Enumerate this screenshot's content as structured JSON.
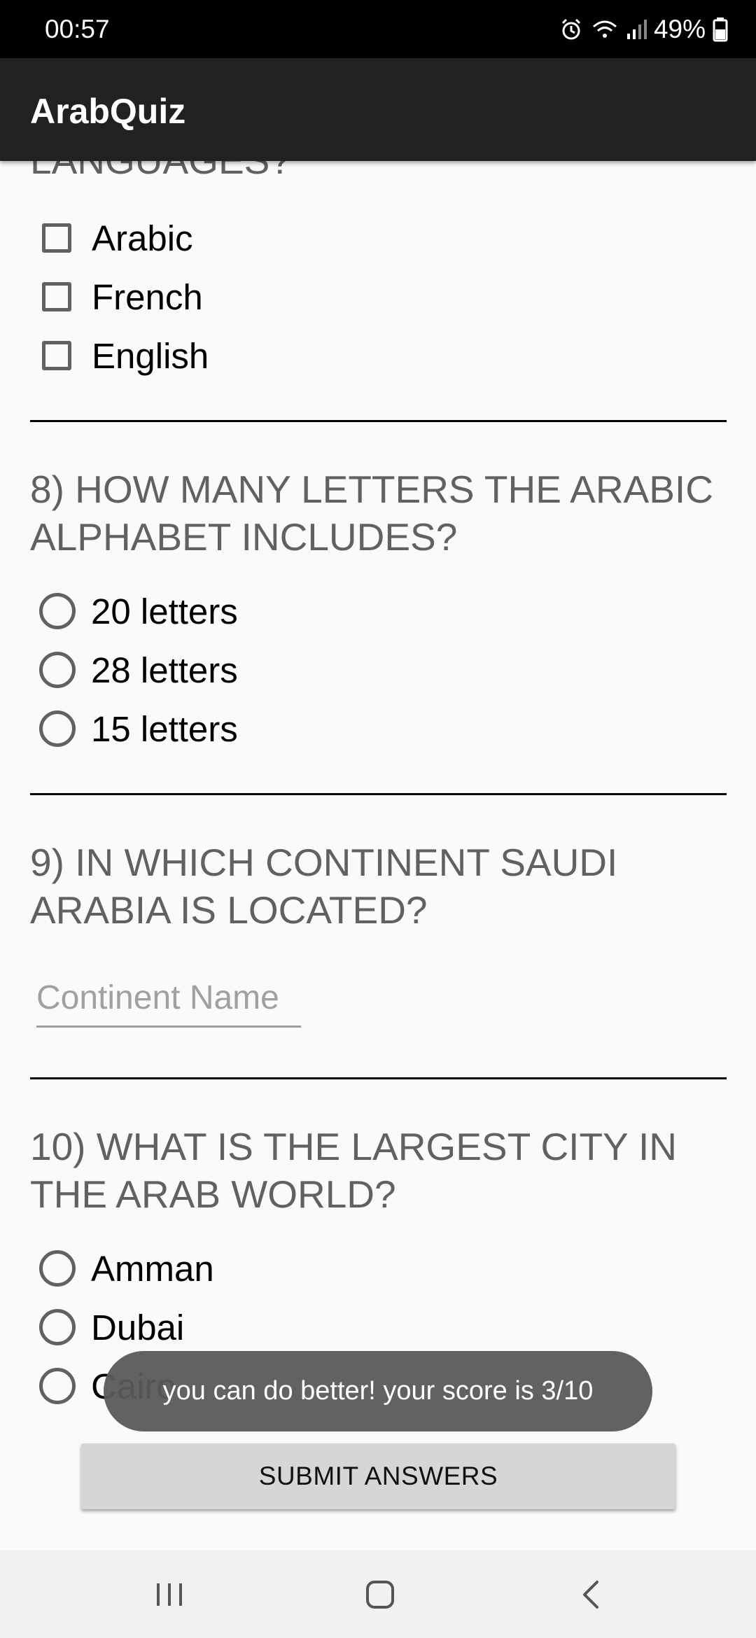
{
  "status_bar": {
    "time": "00:57",
    "battery": "49%",
    "icons": [
      "alarm-icon",
      "wifi-icon",
      "signal-icon",
      "battery-icon"
    ]
  },
  "app_bar": {
    "title": "ArabQuiz"
  },
  "quiz": {
    "q7": {
      "partial_title": "LANGUAGES?",
      "options": [
        "Arabic",
        "French",
        "English"
      ]
    },
    "q8": {
      "title": "8) HOW MANY LETTERS THE ARABIC ALPHABET INCLUDES?",
      "options": [
        "20 letters",
        "28 letters",
        "15 letters"
      ]
    },
    "q9": {
      "title": "9) IN WHICH CONTINENT SAUDI ARABIA IS LOCATED?",
      "input_placeholder": "Continent Name",
      "input_value": ""
    },
    "q10": {
      "title": "10) WHAT IS THE LARGEST CITY IN THE ARAB WORLD?",
      "options": [
        "Amman",
        "Dubai",
        "Cairo"
      ]
    }
  },
  "submit_label": "SUBMIT ANSWERS",
  "toast": "you can do better! your score is 3/10",
  "nav_bar": {
    "icons": [
      "recent-apps-icon",
      "home-icon",
      "back-icon"
    ]
  },
  "colors": {
    "app_bar": "#212121",
    "question_text": "#616161",
    "button_bg": "#d6d6d6",
    "toast_bg": "#5a5a5a"
  }
}
